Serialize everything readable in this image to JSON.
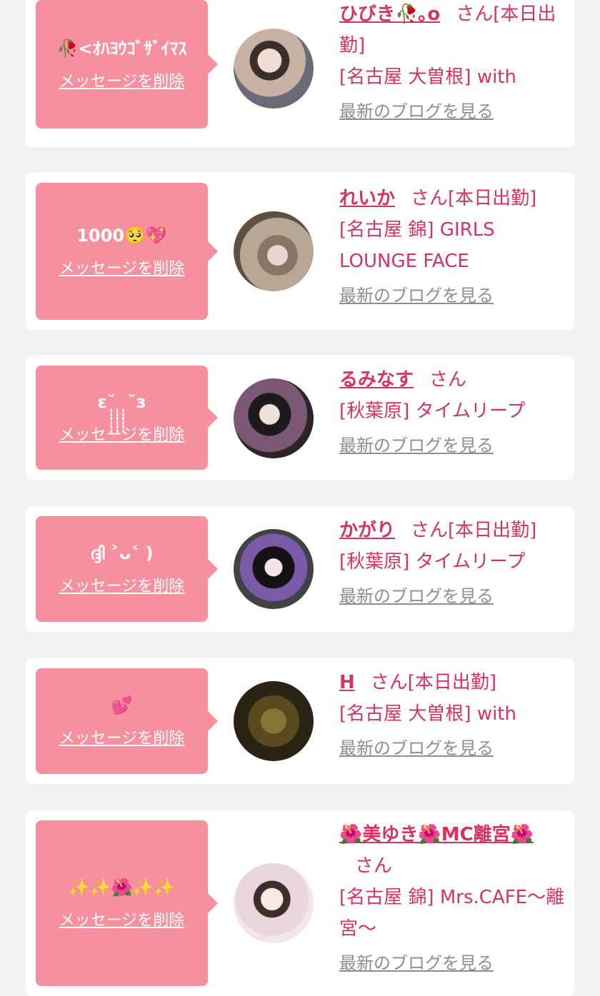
{
  "delete_label": "メッセージを削除",
  "blog_label": "最新のブログを見る",
  "cards": [
    {
      "message": "🥀<ｵﾊﾖｳｺﾞｻﾞｲﾏｽ",
      "name": "ひびき🥀｡o",
      "honorific": "さん",
      "status": "[本日出勤]",
      "shop": "[名古屋 大曽根] with"
    },
    {
      "message": "1000🥺💖",
      "name": "れいか",
      "honorific": "さん",
      "status": "[本日出勤]",
      "shop": "[名古屋 錦] GIRLS LOUNGE FACE"
    },
    {
      "message": "ε˘̩̩̩̩̩̩ ̩̩̩̩̩̩ ̩̩̩̩̩̩˘з",
      "name": "るみなす",
      "honorific": "さん",
      "status": "",
      "shop": "[秋葉原] タイムリープ"
    },
    {
      "message": "ദ്ദി ˃ᴗ˂ )",
      "name": "かがり",
      "honorific": "さん",
      "status": "[本日出勤]",
      "shop": "[秋葉原] タイムリープ"
    },
    {
      "message": "💕",
      "name": "H",
      "honorific": "さん",
      "status": "[本日出勤]",
      "shop": "[名古屋 大曽根] with"
    },
    {
      "message": "✨✨🌺✨✨",
      "name": "🌺美ゆき🌺MC離宮🌺",
      "honorific": "さん",
      "status": "",
      "shop": "[名古屋 錦] Mrs.CAFE～離宮～"
    }
  ]
}
